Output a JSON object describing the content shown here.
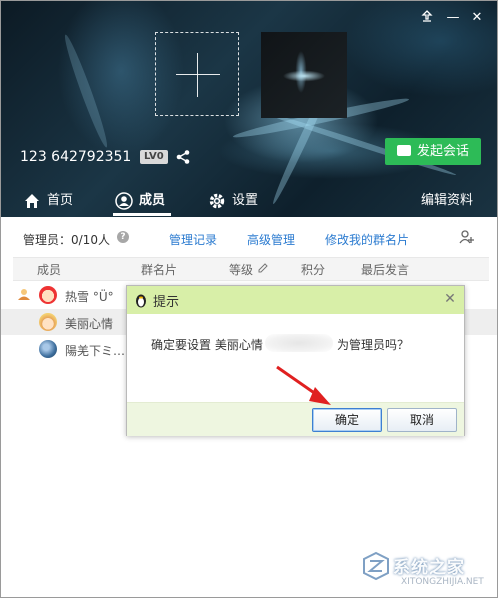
{
  "window_controls": {
    "pin_icon": "pin-icon",
    "minimize": "—",
    "close": "✕"
  },
  "header": {
    "group_number": "123 642792351",
    "level_badge": "LV0",
    "start_chat_label": "发起会话"
  },
  "tabs": [
    {
      "label": "首页",
      "icon": "home-icon"
    },
    {
      "label": "成员",
      "icon": "member-icon",
      "active": true
    },
    {
      "label": "设置",
      "icon": "gear-icon"
    },
    {
      "label": "编辑资料"
    }
  ],
  "toolbar": {
    "admin_count": "管理员：0/10人",
    "help": "?",
    "links": [
      "管理记录",
      "高级管理",
      "修改我的群名片"
    ]
  },
  "columns": [
    "成员",
    "群名片",
    "等级",
    "积分",
    "最后发言"
  ],
  "members": [
    {
      "name": "热雪 °Ü°"
    },
    {
      "name": "美丽心情"
    },
    {
      "name": "陽羌下ミ…"
    }
  ],
  "dialog": {
    "title": "提示",
    "close": "✕",
    "message_prefix": "确定要设置 美丽心情",
    "message_suffix": "为管理员吗？",
    "ok_label": "确定",
    "cancel_label": "取消"
  },
  "watermark": {
    "text": "系统之家",
    "url": "XITONGZHIJIA.NET"
  },
  "colors": {
    "accent_green": "#2dbb57",
    "link_blue": "#2b7bd0",
    "dialog_title_bg": "#d8efa8"
  }
}
